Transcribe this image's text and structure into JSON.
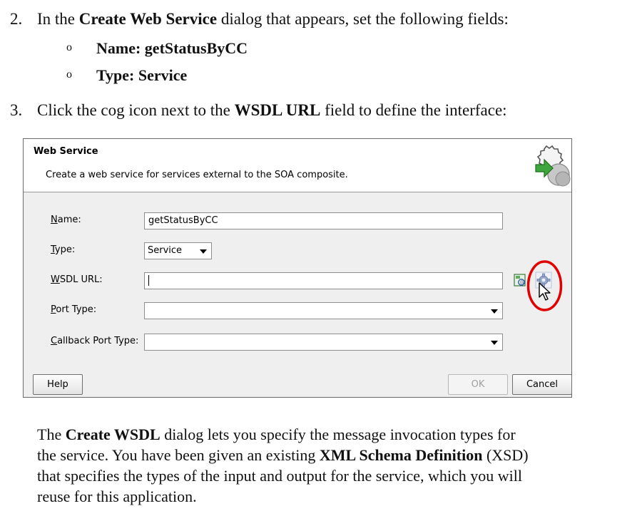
{
  "steps": {
    "step2": {
      "num": "2.",
      "pre": "In the ",
      "bold": "Create Web Service",
      "post": " dialog that appears, set the following fields:"
    },
    "bullets": [
      {
        "mark": "o",
        "label": "Name",
        "value": ": getStatusByCC"
      },
      {
        "mark": "o",
        "label": "Type",
        "value": ": Service"
      }
    ],
    "step3": {
      "num": "3.",
      "pre": "Click the cog icon next to the ",
      "bold": "WSDL URL",
      "post": " field to define the interface:"
    }
  },
  "dialog": {
    "title": "Web Service",
    "description": "Create a web service for services external to the SOA composite.",
    "fields": {
      "name": {
        "label_first": "N",
        "label_rest": "ame:",
        "value": "getStatusByCC"
      },
      "type": {
        "label_first": "T",
        "label_rest": "ype:",
        "value": "Service"
      },
      "wsdl": {
        "label_first": "W",
        "label_rest": "SDL URL:",
        "value": ""
      },
      "port_type": {
        "label_first": "P",
        "label_rest": "ort Type:",
        "value": ""
      },
      "callback_port_type": {
        "label_first": "C",
        "label_rest": "allback Port Type:",
        "value": ""
      }
    },
    "buttons": {
      "help": "Help",
      "ok": "OK",
      "cancel": "Cancel"
    },
    "icons": {
      "browse": "wsdl-browse-icon",
      "cog": "cog-icon",
      "header": "web-service-gear-icon"
    },
    "highlight_color": "#e00000"
  },
  "paragraph": {
    "l1_pre": "The ",
    "l1_bold": "Create WSDL",
    "l1_post": " dialog lets you specify the message invocation types for",
    "l2_pre": "the service. You have been given an existing ",
    "l2_bold": "XML Schema Definition",
    "l2_post": " (XSD)",
    "l3": "that specifies the types of the input and output for the service, which you will",
    "l4": "reuse for this application."
  }
}
